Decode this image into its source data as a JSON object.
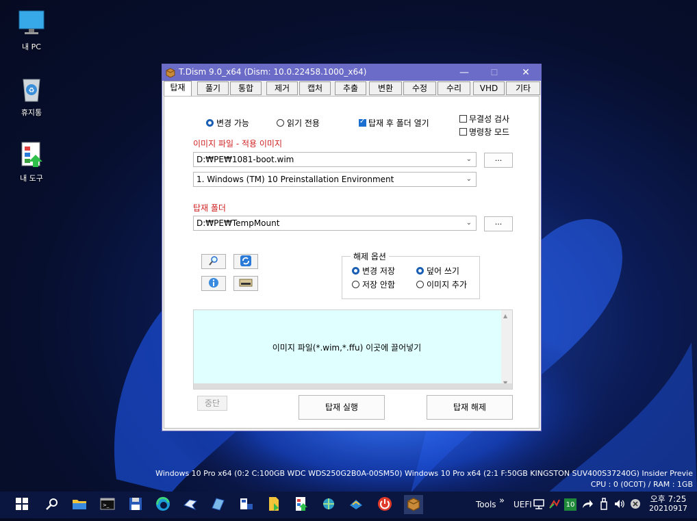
{
  "desktop": {
    "icons": [
      {
        "label": "내 PC",
        "icon": "monitor-icon"
      },
      {
        "label": "휴지통",
        "icon": "recycle-bin-icon"
      },
      {
        "label": "내 도구",
        "icon": "tools-folder-icon"
      }
    ],
    "sysinfo": {
      "line1": "Windows 10 Pro x64 (0:2 C:100GB WDC  WDS250G2B0A-00SM50) Windows 10 Pro x64 (2:1 F:50GB KINGSTON SUV400S37240G) Insider Previe",
      "line2": "CPU : 0 (0C0T) / RAM : 1GB"
    }
  },
  "window": {
    "title": "T.Dism 9.0_x64  (Dism: 10.0.22458.1000_x64)",
    "minimize": "—",
    "maximize": "☐",
    "close": "✕",
    "tabs": [
      "탑재",
      "풀기",
      "통합",
      "제거",
      "캡처",
      "추출",
      "변환",
      "수정",
      "수리",
      "VHD",
      "기타"
    ],
    "active_tab": "탑재"
  },
  "mount": {
    "mode_options": [
      {
        "label": "변경 가능",
        "selected": true
      },
      {
        "label": "읽기 전용",
        "selected": false
      }
    ],
    "open_folder": {
      "label": "탑재 후 폴더 열기",
      "checked": true
    },
    "integrity_check": {
      "label": "무결성 검사",
      "checked": false
    },
    "cmd_mode": {
      "label": "명령창 모드",
      "checked": false
    },
    "image_file_label": "이미지 파일 - 적용 이미지",
    "image_file_value": "D:₩PE₩1081-boot.wim",
    "image_index_value": "1. Windows (TM) 10 Preinstallation Environment",
    "mount_folder_label": "탑재 폴더",
    "mount_folder_value": "D:₩PE₩TempMount",
    "browse_label": "...",
    "unmount_options": {
      "title": "해제 옵션",
      "options": [
        {
          "label": "변경 저장",
          "selected": true
        },
        {
          "label": "저장 안함",
          "selected": false
        },
        {
          "label": "덮어 쓰기",
          "selected": true
        },
        {
          "label": "이미지 추가",
          "selected": false
        }
      ]
    },
    "drop_text": "이미지 파일(*.wim,*.ffu) 이곳에 끌어넣기",
    "stop_label": "중단",
    "mount_run_label": "탑재 실행",
    "unmount_label": "탑재 해제"
  },
  "taskbar": {
    "tools_label": "Tools",
    "uefi_label": "UEFI",
    "badge": "10",
    "time": "오후 7:25",
    "date": "20210917",
    "chevron": "»"
  },
  "colors": {
    "titlebar": "#6b6bc8",
    "accent": "#1a5fb4",
    "red_label": "#d02020",
    "drop_bg": "#e0ffff"
  }
}
